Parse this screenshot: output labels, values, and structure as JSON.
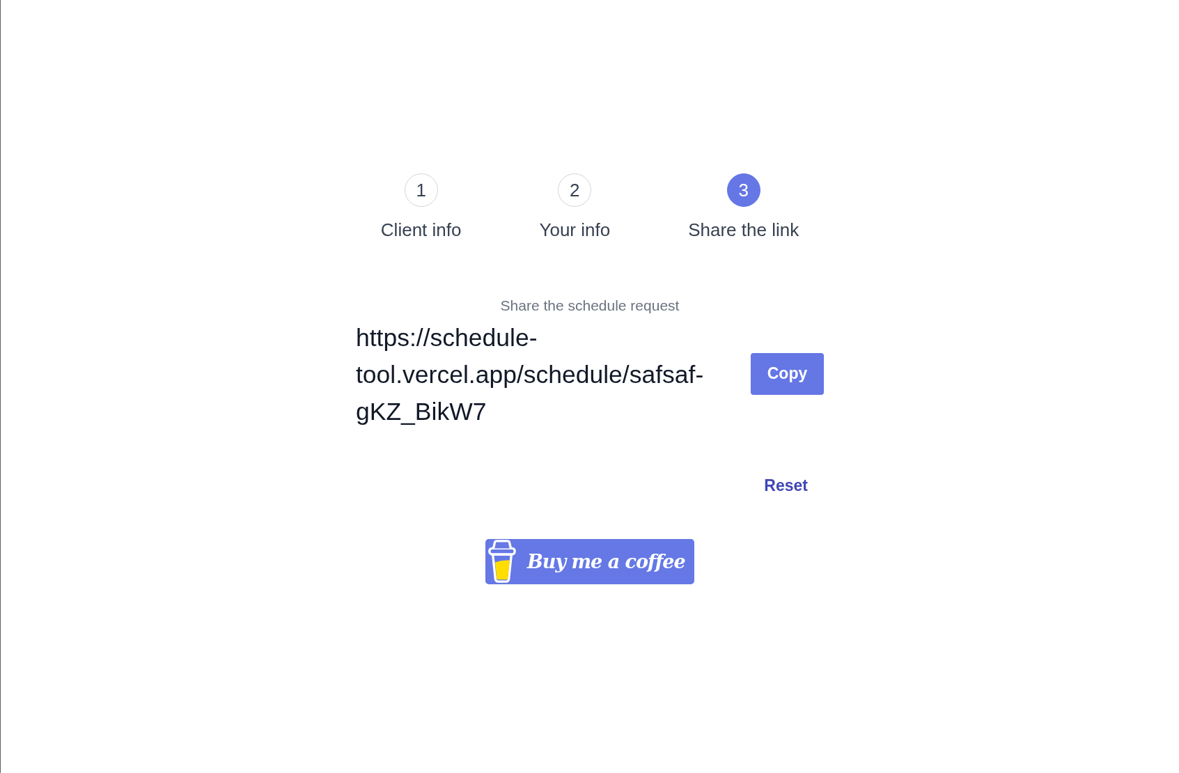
{
  "stepper": {
    "steps": [
      {
        "number": "1",
        "label": "Client info",
        "selected": false
      },
      {
        "number": "2",
        "label": "Your info",
        "selected": false
      },
      {
        "number": "3",
        "label": "Share the link",
        "selected": true
      }
    ]
  },
  "share": {
    "heading": "Share the schedule request",
    "link": "https://schedule-tool.vercel.app/schedule/safsaf-gKZ_BikW7",
    "copy_button": "Copy"
  },
  "reset_link": "Reset",
  "coffee_button": {
    "label": "Buy me a coffee"
  }
}
